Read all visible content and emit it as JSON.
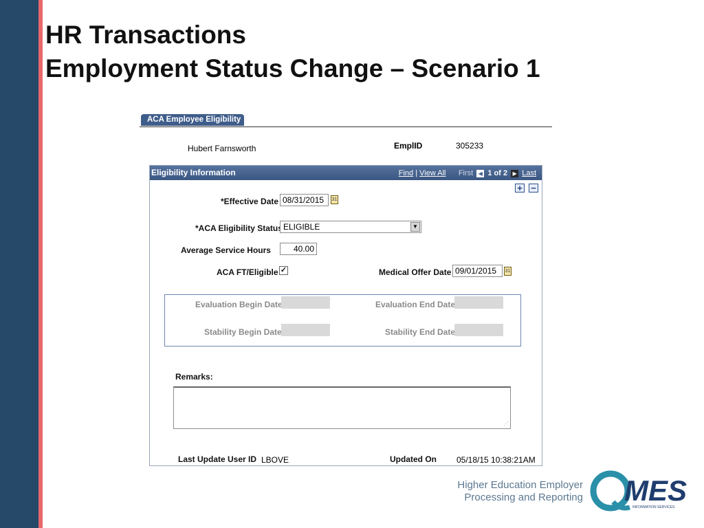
{
  "slide": {
    "title_line1": "HR Transactions",
    "title_line2": "Employment Status Change – Scenario 1",
    "footer_line1": "Higher Education Employer",
    "footer_line2": "Processing and Reporting",
    "logo_text": "MES",
    "logo_subtext": "INFORMATION SERVICES"
  },
  "page": {
    "tab_label": "ACA Employee Eligibility",
    "employee_name": "Hubert Farnsworth",
    "emplid_label": "EmplID",
    "emplid_value": "305233"
  },
  "eligibility": {
    "section_title": "Eligibility Information",
    "nav": {
      "find": "Find",
      "view_all": "View All",
      "first": "First",
      "position": "1 of 2",
      "last": "Last"
    },
    "effective_date_label": "*Effective Date",
    "effective_date_value": "08/31/2015",
    "aca_status_label": "*ACA Eligibility Status",
    "aca_status_value": "ELIGIBLE",
    "avg_hours_label": "Average Service Hours",
    "avg_hours_value": "40.00",
    "aca_ft_label": "ACA FT/Eligible",
    "aca_ft_checked": true,
    "medical_offer_label": "Medical Offer Date",
    "medical_offer_value": "09/01/2015",
    "eval_begin_label": "Evaluation Begin Date",
    "eval_end_label": "Evaluation End Date",
    "stability_begin_label": "Stability Begin Date",
    "stability_end_label": "Stability End Date",
    "remarks_label": "Remarks:",
    "remarks_value": "",
    "last_update_label": "Last Update User ID",
    "last_update_value": "LBOVE",
    "updated_on_label": "Updated On",
    "updated_on_value": "05/18/15 10:38:21AM"
  },
  "icons": {
    "calendar": "calendar-icon",
    "add_row": "+",
    "delete_row": "−",
    "prev": "◀",
    "next": "▶",
    "dropdown": "▼",
    "check": "✓"
  },
  "colors": {
    "sidebar": "#264869",
    "accent": "#e8686c",
    "header": "#3f5d8a"
  }
}
